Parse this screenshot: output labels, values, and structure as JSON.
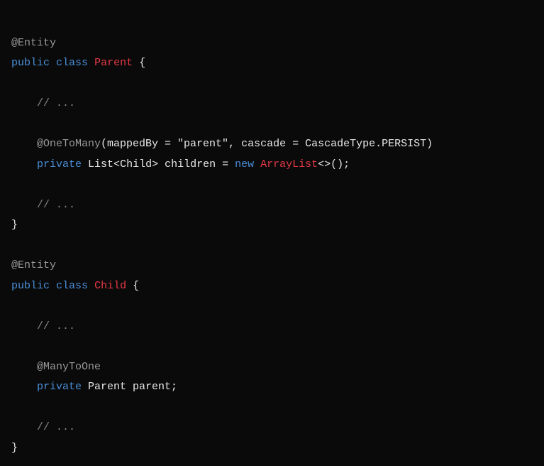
{
  "code": {
    "line1": {
      "annotation": "@Entity"
    },
    "line2": {
      "kw_public": "public",
      "kw_class": "class",
      "classname": "Parent",
      "brace": " {"
    },
    "line4": {
      "comment": "    // ..."
    },
    "line6": {
      "annotation": "    @OneToMany",
      "args": "(mappedBy = \"parent\", cascade = CascadeType.PERSIST)"
    },
    "line7": {
      "kw_private": "    private",
      "type_list": " List",
      "generic_open": "<",
      "child_type": "Child",
      "generic_close": ">",
      "identifier": " children = ",
      "kw_new": "new",
      "arraylist": " ArrayList",
      "diamond": "<>();"
    },
    "line9": {
      "comment": "    // ..."
    },
    "line10": {
      "brace": "}"
    },
    "line12": {
      "annotation": "@Entity"
    },
    "line13": {
      "kw_public": "public",
      "kw_class": "class",
      "classname": "Child",
      "brace": " {"
    },
    "line15": {
      "comment": "    // ..."
    },
    "line17": {
      "annotation": "    @ManyToOne"
    },
    "line18": {
      "kw_private": "    private",
      "type": " Parent parent;"
    },
    "line20": {
      "comment": "    // ..."
    },
    "line21": {
      "brace": "}"
    }
  }
}
